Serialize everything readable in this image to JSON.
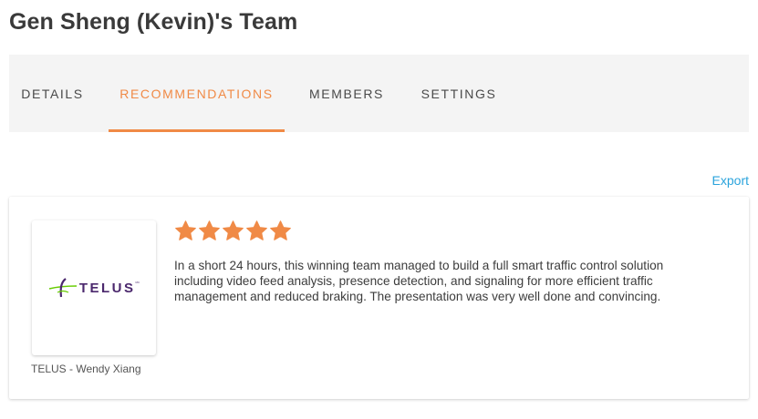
{
  "header": {
    "title": "Gen Sheng (Kevin)'s Team"
  },
  "tabs": [
    {
      "label": "DETAILS",
      "active": false
    },
    {
      "label": "RECOMMENDATIONS",
      "active": true
    },
    {
      "label": "MEMBERS",
      "active": false
    },
    {
      "label": "SETTINGS",
      "active": false
    }
  ],
  "actions": {
    "export_label": "Export"
  },
  "recommendation": {
    "company_logo_text": "TELUS",
    "rating": 5,
    "rating_max": 5,
    "text": "In a short 24 hours, this winning team managed to build a full smart traffic control solution including video feed analysis, presence detection, and signaling for more efficient traffic management and reduced braking. The presentation was very well done and convincing.",
    "author": "TELUS - Wendy Xiang"
  },
  "colors": {
    "accent": "#f08a46",
    "link": "#2aa3dc",
    "star": "#f08a46",
    "telus_purple": "#4b286d",
    "telus_green": "#66cc00"
  },
  "icons": {
    "star": "star-icon",
    "logo": "telus-logo"
  }
}
